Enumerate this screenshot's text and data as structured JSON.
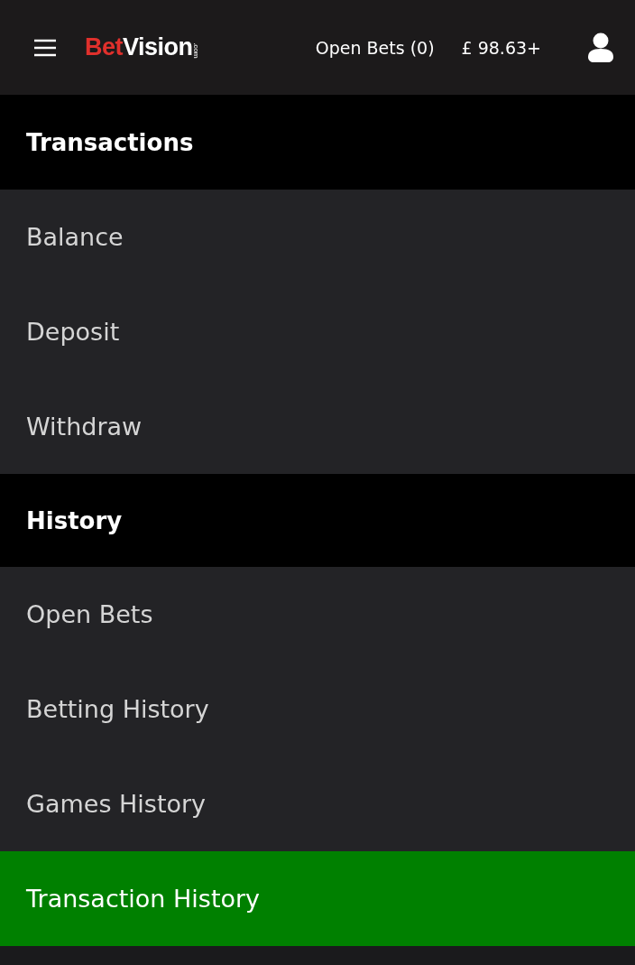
{
  "header": {
    "logo": {
      "parts": [
        {
          "text": "Bet",
          "color": "#e0302c"
        },
        {
          "text": "Vision",
          "color": "#ffffff"
        }
      ],
      "suffix": ".com"
    },
    "open_bets": "Open Bets (0)",
    "balance": "£ 98.63+"
  },
  "sections": [
    {
      "title": "Transactions",
      "items": [
        {
          "label": "Balance",
          "selected": false
        },
        {
          "label": "Deposit",
          "selected": false
        },
        {
          "label": "Withdraw",
          "selected": false
        }
      ]
    },
    {
      "title": "History",
      "items": [
        {
          "label": "Open Bets",
          "selected": false
        },
        {
          "label": "Betting History",
          "selected": false
        },
        {
          "label": "Games History",
          "selected": false
        },
        {
          "label": "Transaction History",
          "selected": true
        }
      ]
    }
  ]
}
